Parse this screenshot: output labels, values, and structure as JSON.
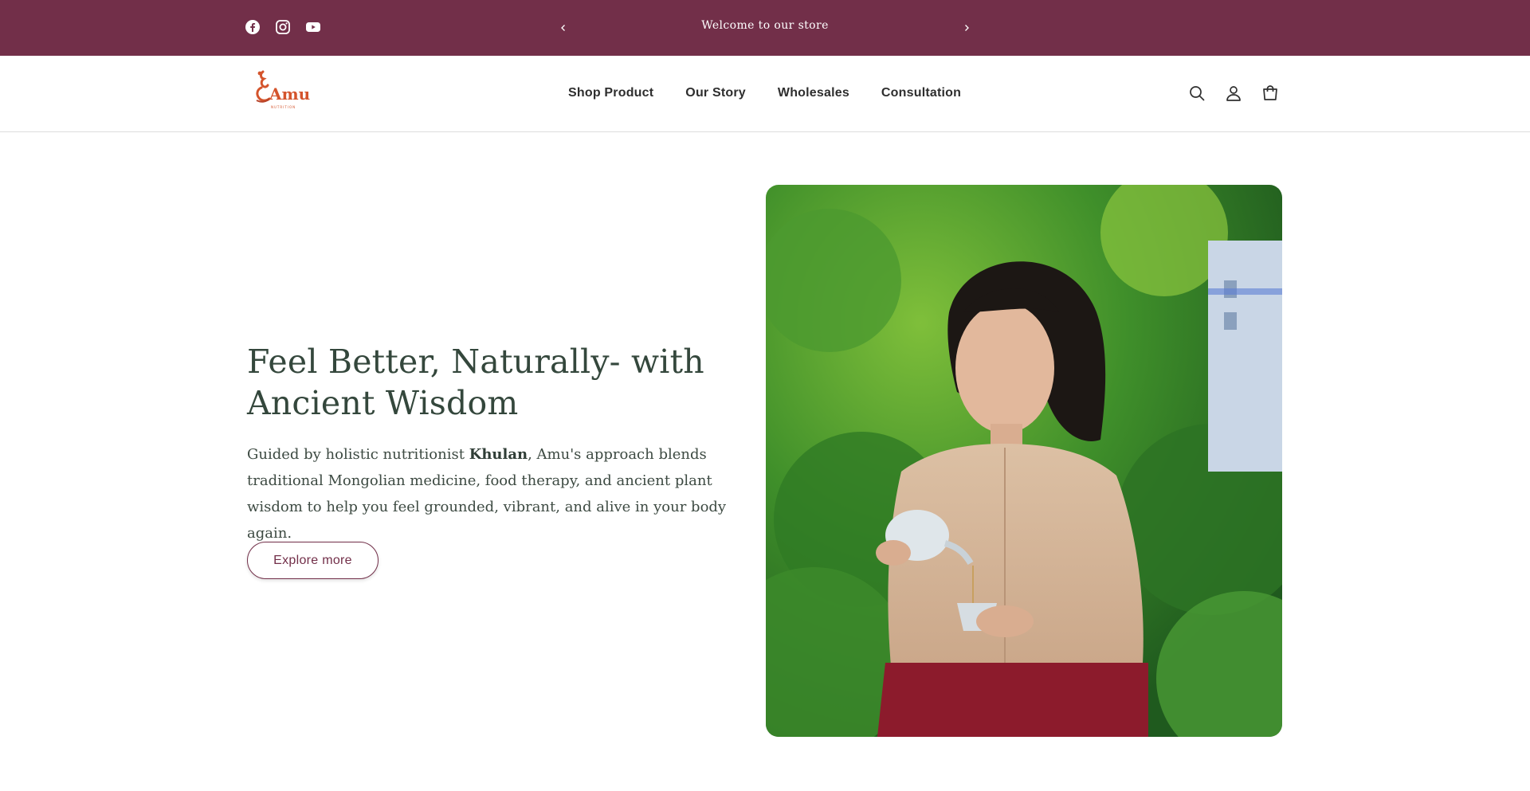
{
  "announcement": {
    "text": "Welcome to our store",
    "social": [
      "facebook-icon",
      "instagram-icon",
      "youtube-icon"
    ],
    "background": "#722f49"
  },
  "header": {
    "logo_text": "Amu",
    "logo_subtext": "NUTRITION",
    "nav": [
      {
        "label": "Shop Product"
      },
      {
        "label": "Our Story"
      },
      {
        "label": "Wholesales"
      },
      {
        "label": "Consultation"
      }
    ],
    "icons": [
      "search-icon",
      "account-icon",
      "cart-icon"
    ]
  },
  "hero": {
    "title": "Feel Better, Naturally- with Ancient Wisdom",
    "desc_prefix": "Guided by holistic nutritionist ",
    "desc_name": "Khulan",
    "desc_suffix": ", Amu's approach blends traditional Mongolian medicine, food therapy, and ancient plant wisdom to help you feel grounded, vibrant, and alive in your body again.",
    "button_label": "Explore more",
    "image_alt": "Woman pouring tea in a garden"
  },
  "colors": {
    "brand": "#722f49",
    "heading": "#34473c",
    "logo": "#d4542c"
  }
}
